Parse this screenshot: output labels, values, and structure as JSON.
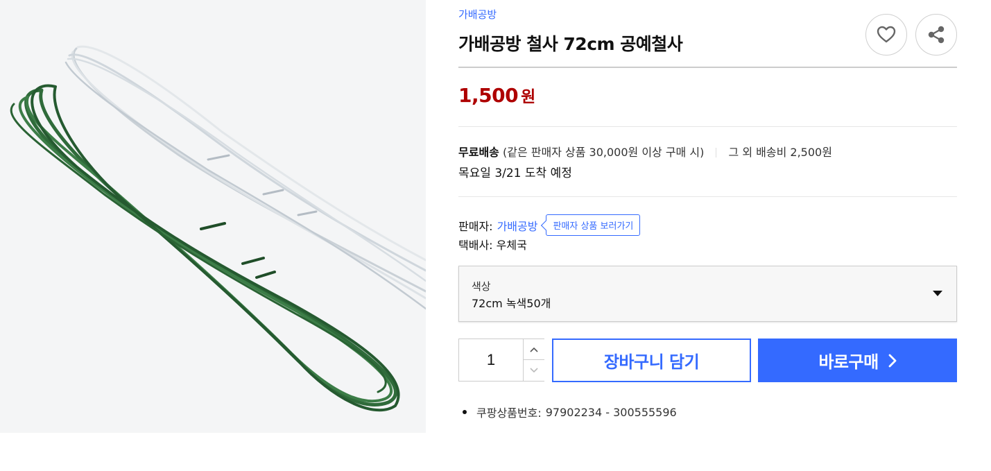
{
  "product": {
    "brand": "가배공방",
    "title": "가배공방 철사 72cm 공예철사",
    "image_description": "green and white craft wire bundles"
  },
  "actions": {
    "like_icon": "heart-icon",
    "share_icon": "share-icon"
  },
  "price": {
    "amount": "1,500",
    "unit": "원",
    "color": "#ae0000"
  },
  "shipping": {
    "free_label": "무료배송",
    "condition": "(같은 판매자 상품 30,000원 이상 구매 시)",
    "other_fee": "그 외 배송비 2,500원",
    "delivery_estimate": "목요일 3/21 도착 예정"
  },
  "seller": {
    "label": "판매자:",
    "name": "가배공방",
    "view_products": "판매자 상품 보러가기",
    "courier_label": "택배사:",
    "courier": "우체국"
  },
  "option": {
    "label": "색상",
    "value": "72cm 녹색50개"
  },
  "quantity": {
    "value": "1"
  },
  "buttons": {
    "cart": "장바구니 담기",
    "buy": "바로구매"
  },
  "product_number": {
    "label": "쿠팡상품번호:",
    "value": "97902234 - 300555596"
  },
  "colors": {
    "accent": "#346aff",
    "price": "#ae0000"
  }
}
